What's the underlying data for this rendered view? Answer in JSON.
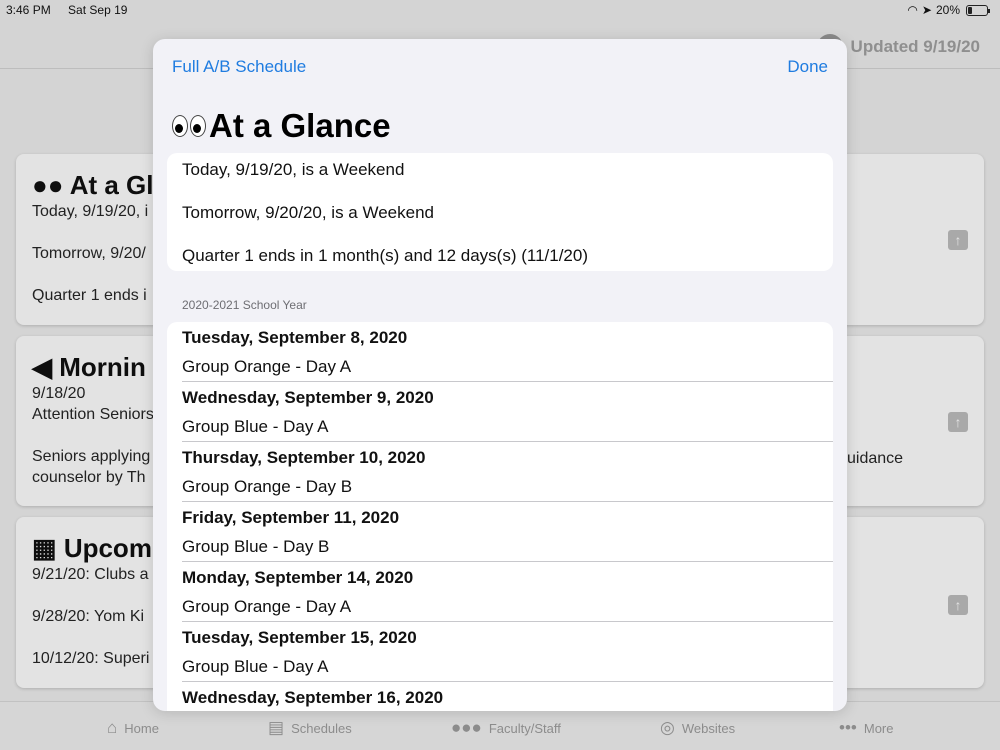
{
  "status_bar": {
    "time": "3:46 PM",
    "date": "Sat Sep 19",
    "battery": "20%"
  },
  "background": {
    "updated_label": "Updated 9/19/20",
    "cards": [
      {
        "title": "At a Gla",
        "lines": [
          "Today, 9/19/20, i",
          "",
          "Tomorrow, 9/20/",
          "",
          "Quarter 1 ends i"
        ]
      },
      {
        "title": "Mornin",
        "lines": [
          "9/18/20",
          "Attention Seniors",
          "",
          "Seniors applying",
          "counselor by Th"
        ],
        "right_text": "uidance"
      },
      {
        "title": "Upcom",
        "lines": [
          "9/21/20: Clubs a",
          "",
          "9/28/20: Yom Ki",
          "",
          "10/12/20: Superi"
        ]
      }
    ]
  },
  "tab_bar": {
    "items": [
      "Home",
      "Schedules",
      "Faculty/Staff",
      "Websites",
      "More"
    ]
  },
  "sheet": {
    "left_button": "Full A/B Schedule",
    "right_button": "Done",
    "title": "At a Glance",
    "glance": [
      "Today, 9/19/20, is a Weekend",
      "Tomorrow, 9/20/20, is a Weekend",
      "Quarter 1 ends in 1 month(s) and 12 days(s) (11/1/20)"
    ],
    "section_header": "2020-2021 School Year",
    "schedule": [
      {
        "date": "Tuesday, September 8, 2020",
        "group": "Group Orange - Day A"
      },
      {
        "date": "Wednesday, September 9, 2020",
        "group": "Group Blue - Day A"
      },
      {
        "date": "Thursday, September 10, 2020",
        "group": "Group Orange - Day B"
      },
      {
        "date": "Friday, September 11, 2020",
        "group": "Group Blue - Day B"
      },
      {
        "date": "Monday, September 14, 2020",
        "group": "Group Orange - Day A"
      },
      {
        "date": "Tuesday, September 15, 2020",
        "group": "Group Blue - Day A"
      },
      {
        "date": "Wednesday, September 16, 2020",
        "group": ""
      }
    ]
  },
  "colors": {
    "accent": "#1f7ce0",
    "sheet_bg": "#f2f2f7",
    "dim_bg": "#d4d4d4"
  }
}
